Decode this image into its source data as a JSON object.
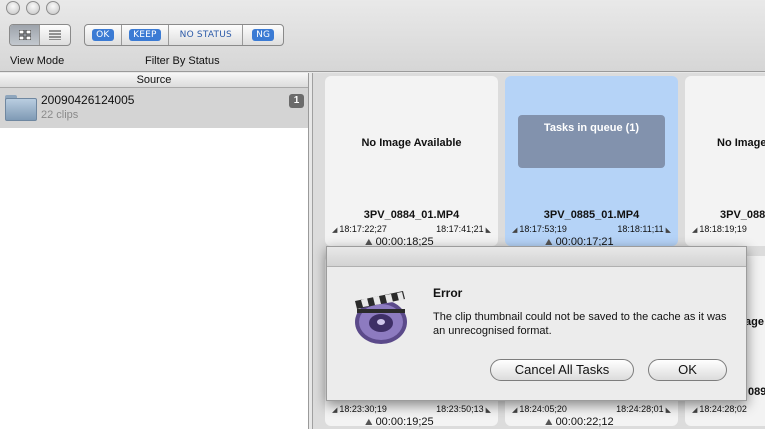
{
  "toolbar": {
    "view_mode_label": "View Mode",
    "filter_label": "Filter By Status",
    "filters": [
      "OK",
      "KEEP",
      "NO STATUS",
      "NG"
    ]
  },
  "source": {
    "header": "Source",
    "item_name": "20090426124005",
    "item_clips": "22 clips",
    "item_badge": "1"
  },
  "clips": [
    {
      "image_text": "No Image Available",
      "name": "3PV_0884_01.MP4",
      "in": "18:17:22;27",
      "out": "18:17:41;21",
      "duration": "00:00:18;25"
    },
    {
      "image_text": "Tasks in queue (1)",
      "name": "3PV_0885_01.MP4",
      "in": "18:17:53;19",
      "out": "18:18:11;11",
      "duration": "00:00:17;21"
    },
    {
      "image_text": "No Image",
      "name": "3PV_088",
      "in": "18:18:19;19",
      "out": "",
      "duration": ""
    }
  ],
  "clips_row2": [
    {
      "in": "18:23:30;19",
      "out": "18:23:50;13",
      "duration": "00:00:19;25"
    },
    {
      "in": "18:24:05;20",
      "out": "18:24:28;01",
      "duration": "00:00:22;12"
    },
    {
      "in": "18:24:28;02",
      "out": "",
      "duration": ""
    }
  ],
  "partial_right": {
    "text1": "age",
    "text2": "089"
  },
  "dialog": {
    "title": "Error",
    "message": "The clip thumbnail could not be saved to the cache as it was an unrecognised format.",
    "cancel_label": "Cancel All Tasks",
    "ok_label": "OK"
  }
}
